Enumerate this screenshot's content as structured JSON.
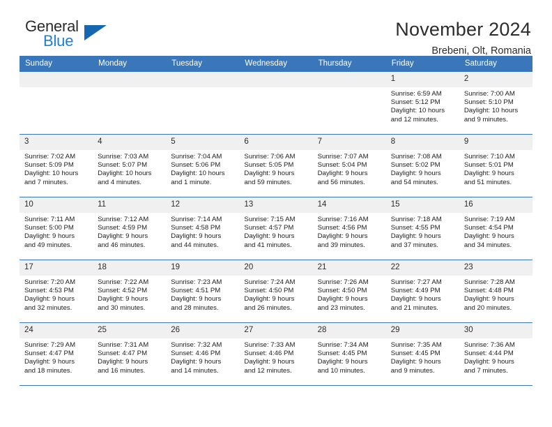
{
  "brand": {
    "name_part1": "General",
    "name_part2": "Blue",
    "accent_color": "#1567b0",
    "text_color": "#1b7fd4"
  },
  "header": {
    "title": "November 2024",
    "subtitle": "Brebeni, Olt, Romania"
  },
  "theme": {
    "header_blue": "#3a76ba",
    "daynum_gray": "#f0f0f0"
  },
  "weekday_headers": [
    "Sunday",
    "Monday",
    "Tuesday",
    "Wednesday",
    "Thursday",
    "Friday",
    "Saturday"
  ],
  "labels": {
    "sunrise": "Sunrise:",
    "sunset": "Sunset:",
    "daylight": "Daylight:"
  },
  "weeks": [
    [
      {
        "day": "",
        "empty": true
      },
      {
        "day": "",
        "empty": true
      },
      {
        "day": "",
        "empty": true
      },
      {
        "day": "",
        "empty": true
      },
      {
        "day": "",
        "empty": true
      },
      {
        "day": "1",
        "sunrise": "Sunrise: 6:59 AM",
        "sunset": "Sunset: 5:12 PM",
        "daylight_line1": "Daylight: 10 hours",
        "daylight_line2": "and 12 minutes."
      },
      {
        "day": "2",
        "sunrise": "Sunrise: 7:00 AM",
        "sunset": "Sunset: 5:10 PM",
        "daylight_line1": "Daylight: 10 hours",
        "daylight_line2": "and 9 minutes."
      }
    ],
    [
      {
        "day": "3",
        "sunrise": "Sunrise: 7:02 AM",
        "sunset": "Sunset: 5:09 PM",
        "daylight_line1": "Daylight: 10 hours",
        "daylight_line2": "and 7 minutes."
      },
      {
        "day": "4",
        "sunrise": "Sunrise: 7:03 AM",
        "sunset": "Sunset: 5:07 PM",
        "daylight_line1": "Daylight: 10 hours",
        "daylight_line2": "and 4 minutes."
      },
      {
        "day": "5",
        "sunrise": "Sunrise: 7:04 AM",
        "sunset": "Sunset: 5:06 PM",
        "daylight_line1": "Daylight: 10 hours",
        "daylight_line2": "and 1 minute."
      },
      {
        "day": "6",
        "sunrise": "Sunrise: 7:06 AM",
        "sunset": "Sunset: 5:05 PM",
        "daylight_line1": "Daylight: 9 hours",
        "daylight_line2": "and 59 minutes."
      },
      {
        "day": "7",
        "sunrise": "Sunrise: 7:07 AM",
        "sunset": "Sunset: 5:04 PM",
        "daylight_line1": "Daylight: 9 hours",
        "daylight_line2": "and 56 minutes."
      },
      {
        "day": "8",
        "sunrise": "Sunrise: 7:08 AM",
        "sunset": "Sunset: 5:02 PM",
        "daylight_line1": "Daylight: 9 hours",
        "daylight_line2": "and 54 minutes."
      },
      {
        "day": "9",
        "sunrise": "Sunrise: 7:10 AM",
        "sunset": "Sunset: 5:01 PM",
        "daylight_line1": "Daylight: 9 hours",
        "daylight_line2": "and 51 minutes."
      }
    ],
    [
      {
        "day": "10",
        "sunrise": "Sunrise: 7:11 AM",
        "sunset": "Sunset: 5:00 PM",
        "daylight_line1": "Daylight: 9 hours",
        "daylight_line2": "and 49 minutes."
      },
      {
        "day": "11",
        "sunrise": "Sunrise: 7:12 AM",
        "sunset": "Sunset: 4:59 PM",
        "daylight_line1": "Daylight: 9 hours",
        "daylight_line2": "and 46 minutes."
      },
      {
        "day": "12",
        "sunrise": "Sunrise: 7:14 AM",
        "sunset": "Sunset: 4:58 PM",
        "daylight_line1": "Daylight: 9 hours",
        "daylight_line2": "and 44 minutes."
      },
      {
        "day": "13",
        "sunrise": "Sunrise: 7:15 AM",
        "sunset": "Sunset: 4:57 PM",
        "daylight_line1": "Daylight: 9 hours",
        "daylight_line2": "and 41 minutes."
      },
      {
        "day": "14",
        "sunrise": "Sunrise: 7:16 AM",
        "sunset": "Sunset: 4:56 PM",
        "daylight_line1": "Daylight: 9 hours",
        "daylight_line2": "and 39 minutes."
      },
      {
        "day": "15",
        "sunrise": "Sunrise: 7:18 AM",
        "sunset": "Sunset: 4:55 PM",
        "daylight_line1": "Daylight: 9 hours",
        "daylight_line2": "and 37 minutes."
      },
      {
        "day": "16",
        "sunrise": "Sunrise: 7:19 AM",
        "sunset": "Sunset: 4:54 PM",
        "daylight_line1": "Daylight: 9 hours",
        "daylight_line2": "and 34 minutes."
      }
    ],
    [
      {
        "day": "17",
        "sunrise": "Sunrise: 7:20 AM",
        "sunset": "Sunset: 4:53 PM",
        "daylight_line1": "Daylight: 9 hours",
        "daylight_line2": "and 32 minutes."
      },
      {
        "day": "18",
        "sunrise": "Sunrise: 7:22 AM",
        "sunset": "Sunset: 4:52 PM",
        "daylight_line1": "Daylight: 9 hours",
        "daylight_line2": "and 30 minutes."
      },
      {
        "day": "19",
        "sunrise": "Sunrise: 7:23 AM",
        "sunset": "Sunset: 4:51 PM",
        "daylight_line1": "Daylight: 9 hours",
        "daylight_line2": "and 28 minutes."
      },
      {
        "day": "20",
        "sunrise": "Sunrise: 7:24 AM",
        "sunset": "Sunset: 4:50 PM",
        "daylight_line1": "Daylight: 9 hours",
        "daylight_line2": "and 26 minutes."
      },
      {
        "day": "21",
        "sunrise": "Sunrise: 7:26 AM",
        "sunset": "Sunset: 4:50 PM",
        "daylight_line1": "Daylight: 9 hours",
        "daylight_line2": "and 23 minutes."
      },
      {
        "day": "22",
        "sunrise": "Sunrise: 7:27 AM",
        "sunset": "Sunset: 4:49 PM",
        "daylight_line1": "Daylight: 9 hours",
        "daylight_line2": "and 21 minutes."
      },
      {
        "day": "23",
        "sunrise": "Sunrise: 7:28 AM",
        "sunset": "Sunset: 4:48 PM",
        "daylight_line1": "Daylight: 9 hours",
        "daylight_line2": "and 20 minutes."
      }
    ],
    [
      {
        "day": "24",
        "sunrise": "Sunrise: 7:29 AM",
        "sunset": "Sunset: 4:47 PM",
        "daylight_line1": "Daylight: 9 hours",
        "daylight_line2": "and 18 minutes."
      },
      {
        "day": "25",
        "sunrise": "Sunrise: 7:31 AM",
        "sunset": "Sunset: 4:47 PM",
        "daylight_line1": "Daylight: 9 hours",
        "daylight_line2": "and 16 minutes."
      },
      {
        "day": "26",
        "sunrise": "Sunrise: 7:32 AM",
        "sunset": "Sunset: 4:46 PM",
        "daylight_line1": "Daylight: 9 hours",
        "daylight_line2": "and 14 minutes."
      },
      {
        "day": "27",
        "sunrise": "Sunrise: 7:33 AM",
        "sunset": "Sunset: 4:46 PM",
        "daylight_line1": "Daylight: 9 hours",
        "daylight_line2": "and 12 minutes."
      },
      {
        "day": "28",
        "sunrise": "Sunrise: 7:34 AM",
        "sunset": "Sunset: 4:45 PM",
        "daylight_line1": "Daylight: 9 hours",
        "daylight_line2": "and 10 minutes."
      },
      {
        "day": "29",
        "sunrise": "Sunrise: 7:35 AM",
        "sunset": "Sunset: 4:45 PM",
        "daylight_line1": "Daylight: 9 hours",
        "daylight_line2": "and 9 minutes."
      },
      {
        "day": "30",
        "sunrise": "Sunrise: 7:36 AM",
        "sunset": "Sunset: 4:44 PM",
        "daylight_line1": "Daylight: 9 hours",
        "daylight_line2": "and 7 minutes."
      }
    ]
  ]
}
